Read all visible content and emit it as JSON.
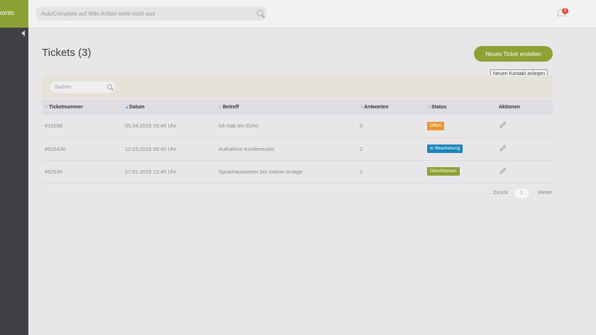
{
  "sidebar": {
    "brand_label": "konto"
  },
  "topbar": {
    "search_placeholder": "AutoComplete auf Wiki-Artikel steht noch aus",
    "notification_count": "3"
  },
  "page": {
    "title": "Tickets (3)",
    "new_ticket_label": "Neues Ticket erstellen",
    "tooltip": "Neuen Kontakt anlegen",
    "table_search_placeholder": "Suchen"
  },
  "table": {
    "columns": [
      "Ticketnummer",
      "Datum",
      "Betreff",
      "Antworten",
      "Status",
      "Aktionen"
    ],
    "rows": [
      {
        "id": "#10036",
        "date": "05.04.2015 15:45 Uhr",
        "subject": "Ich hab ein Echo",
        "answers": "0",
        "status": "Offen",
        "status_color": "#e59a2f"
      },
      {
        "id": "#525436",
        "date": "12.03.2015 09:45 Uhr",
        "subject": "Aufnahme Konferenzen",
        "answers": "2",
        "status": "In Bearbeitung",
        "status_color": "#1a86b8"
      },
      {
        "id": "#52536",
        "date": "27.01.2015 12:45 Uhr",
        "subject": "Sprachaussetzer bei meiner Anlage",
        "answers": "1",
        "status": "Geschlossen",
        "status_color": "#8da234"
      }
    ]
  },
  "pagination": {
    "prev": "Zurück",
    "current": "1",
    "next": "Weiter"
  },
  "colors": {
    "accent": "#8da234",
    "sidebar": "#3f4147",
    "badge": "#e74c3c"
  },
  "icons": {
    "search": "search-icon",
    "bell": "bell-icon",
    "edit": "pencil-icon",
    "collapse": "triangle-left-icon"
  }
}
